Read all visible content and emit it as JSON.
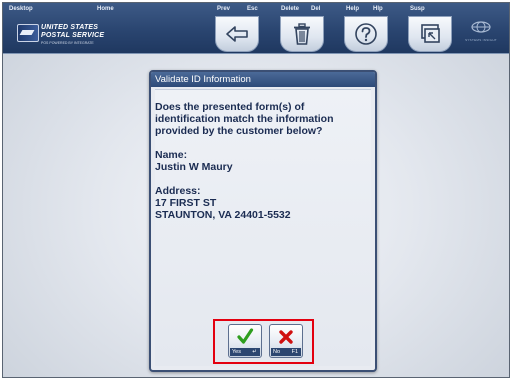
{
  "toolbar": {
    "desktop_label": "Desktop",
    "home_label": "Home",
    "prev_label": "Prev",
    "prev_key": "Esc",
    "delete_label": "Delete",
    "delete_key": "Del",
    "help_label": "Help",
    "help_key": "Hlp",
    "susp_label": "Susp",
    "logo": {
      "line1": "UNITED STATES",
      "line2": "POSTAL SERVICE",
      "line3": "POS POWERED BY INTEGRATE"
    },
    "brand_text": "SYSTEMS INSIGHT",
    "icons": {
      "prev": "arrow-left-icon",
      "delete": "trash-icon",
      "help": "question-mark-icon",
      "susp": "suspend-window-icon"
    }
  },
  "dialog": {
    "title": "Validate ID Information",
    "question_line1": "Does the presented form(s) of",
    "question_line2": "identification match the information",
    "question_line3": "provided by the customer below?",
    "name_label": "Name:",
    "name_value": "Justin W Maury",
    "address_label": "Address:",
    "address_line1": "17 FIRST ST",
    "address_line2": "STAUNTON, VA 24401-5532",
    "yes_button": {
      "label": "Yes",
      "key": "↵",
      "icon": "checkmark-icon",
      "color": "#2e9e1e"
    },
    "no_button": {
      "label": "No",
      "key": "F1",
      "icon": "x-mark-icon",
      "color": "#d01010"
    }
  },
  "colors": {
    "toolbar": "#2a4570",
    "dialog_border": "#3b4f74",
    "dialog_text": "#1b2c52",
    "highlight": "#e3000f"
  }
}
